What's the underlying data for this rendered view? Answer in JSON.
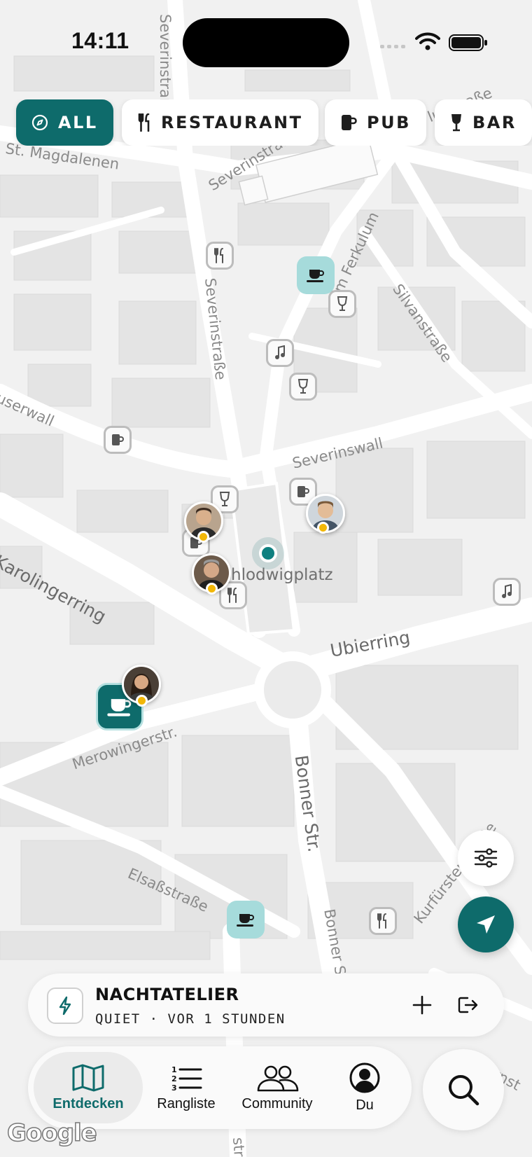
{
  "status_bar": {
    "time": "14:11"
  },
  "filters": [
    {
      "label": "ALL",
      "icon": "compass-icon",
      "active": true
    },
    {
      "label": "RESTAURANT",
      "icon": "fork-knife-icon",
      "active": false
    },
    {
      "label": "PUB",
      "icon": "beer-mug-icon",
      "active": false
    },
    {
      "label": "BAR",
      "icon": "wine-glass-icon",
      "active": false
    }
  ],
  "map": {
    "streets": [
      "Severinstraße",
      "St. Magdalenen",
      "Severinstraße",
      "Im Ferkulum",
      "Silvanstraße",
      "Severinstraße",
      "userwall",
      "Severinswall",
      "Karolingerring",
      "Ubierring",
      "Merowingerstr.",
      "Bonner Str.",
      "Elsaßstraße",
      "Bonner S",
      "Kurfürstenstraße",
      "rnst",
      "lusstraße",
      "str"
    ],
    "place": "hlodwigplatz"
  },
  "venue_card": {
    "name": "NACHTATELIER",
    "status": "QUIET · VOR 1 STUNDEN"
  },
  "tabs": [
    {
      "label": "Entdecken",
      "icon": "map-icon",
      "active": true
    },
    {
      "label": "Rangliste",
      "icon": "ranked-list-icon",
      "active": false
    },
    {
      "label": "Community",
      "icon": "people-icon",
      "active": false
    },
    {
      "label": "Du",
      "icon": "profile-icon",
      "active": false
    }
  ],
  "attribution": "Google",
  "colors": {
    "accent": "#0e6b6b",
    "pin_light": "#a6dbdb",
    "status_dot": "#f2b707"
  }
}
